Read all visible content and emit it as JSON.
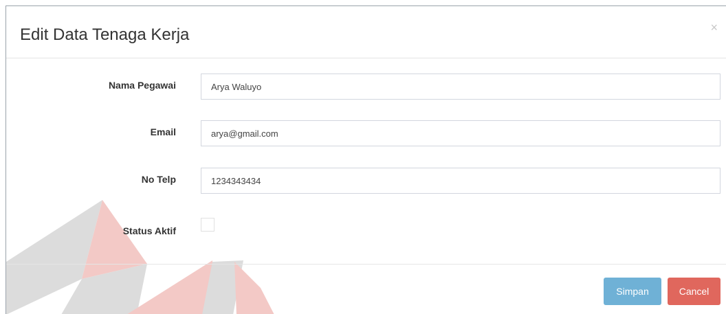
{
  "modal": {
    "title": "Edit Data Tenaga Kerja",
    "close_glyph": "×"
  },
  "form": {
    "fields": [
      {
        "label": "Nama Pegawai",
        "value": "Arya Waluyo"
      },
      {
        "label": "Email",
        "value": "arya@gmail.com"
      },
      {
        "label": "No Telp",
        "value": "1234343434"
      }
    ],
    "status": {
      "label": "Status Aktif",
      "checked": false
    }
  },
  "footer": {
    "save_label": "Simpan",
    "cancel_label": "Cancel"
  },
  "colors": {
    "save_button": "#6fb1d6",
    "cancel_button": "#e0675d",
    "watermark_red": "#f3c9c6",
    "watermark_gray": "#dcdcdc"
  },
  "icons": {
    "close": "close-icon",
    "watermark": "background-logo-watermark"
  }
}
